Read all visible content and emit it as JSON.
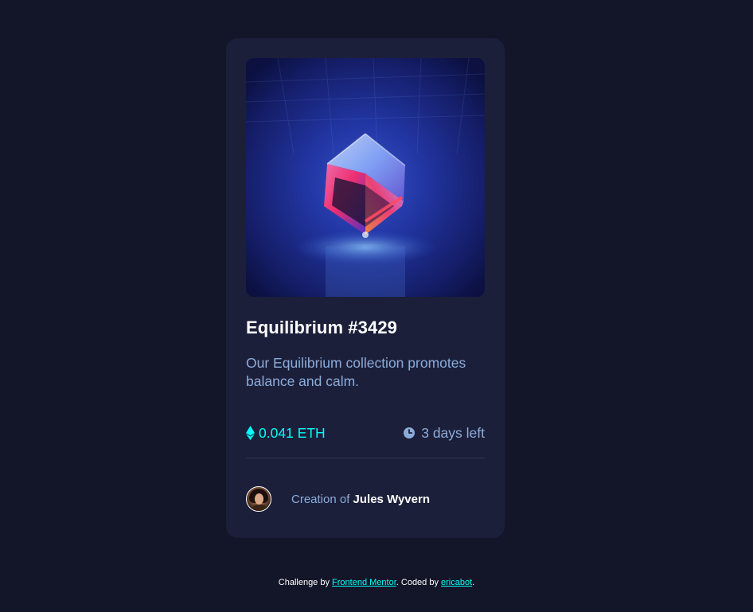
{
  "card": {
    "image_alt": "Equilibrium",
    "title": "Equilibrium #3429",
    "description": "Our Equilibrium collection promotes balance and calm.",
    "price": "0.041 ETH",
    "time_left": "3 days left",
    "creator_prefix": "Creation of",
    "creator_name": "Jules Wyvern"
  },
  "footer": {
    "prefix": "Challenge by",
    "link1": "Frontend Mentor",
    "middle": ". Coded by",
    "link2": "ericabot",
    "suffix": "."
  },
  "icons": {
    "eth": "ethereum-icon",
    "clock": "clock-icon"
  },
  "colors": {
    "page_bg": "#131629",
    "card_bg": "#1c1f3a",
    "cyan": "#00fff8",
    "soft_blue": "#8bacd9",
    "white": "#ffffff"
  }
}
